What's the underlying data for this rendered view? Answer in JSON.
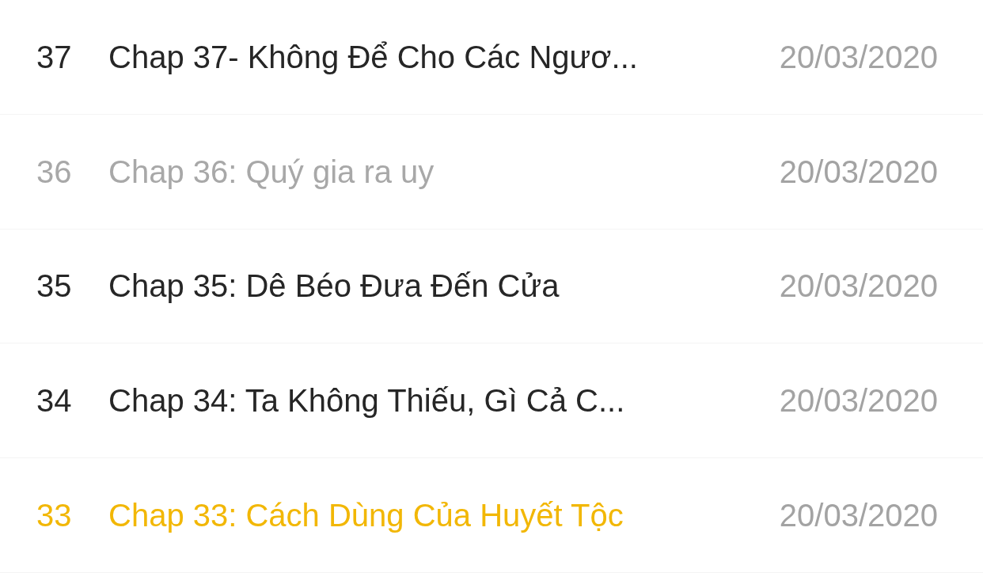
{
  "chapters": [
    {
      "number": "37",
      "title": "Chap 37- Không Để Cho Các Ngươ...",
      "date": "20/03/2020",
      "read": false,
      "selected": false
    },
    {
      "number": "36",
      "title": "Chap 36: Quý gia ra uy",
      "date": "20/03/2020",
      "read": true,
      "selected": false
    },
    {
      "number": "35",
      "title": "Chap 35: Dê Béo Đưa Đến Cửa",
      "date": "20/03/2020",
      "read": false,
      "selected": false
    },
    {
      "number": "34",
      "title": "Chap 34: Ta Không Thiếu, Gì Cả C...",
      "date": "20/03/2020",
      "read": false,
      "selected": false
    },
    {
      "number": "33",
      "title": "Chap 33: Cách Dùng Của Huyết Tộc",
      "date": "20/03/2020",
      "read": false,
      "selected": true
    }
  ]
}
